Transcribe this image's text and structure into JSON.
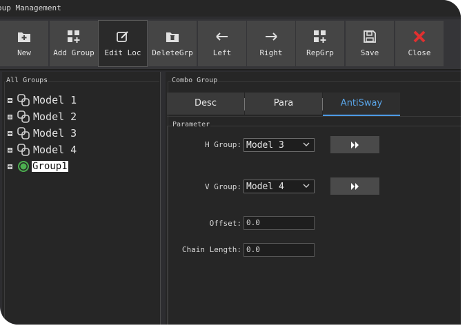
{
  "window": {
    "title": "oup Management"
  },
  "toolbar": {
    "buttons": [
      {
        "label": "New",
        "icon": "folder-plus-icon"
      },
      {
        "label": "Add Group",
        "icon": "grid-plus-icon"
      },
      {
        "label": "Edit Loc",
        "icon": "edit-icon"
      },
      {
        "label": "DeleteGrp",
        "icon": "folder-delete-icon"
      },
      {
        "label": "Left",
        "icon": "arrow-left-icon"
      },
      {
        "label": "Right",
        "icon": "arrow-right-icon"
      },
      {
        "label": "RepGrp",
        "icon": "grid-plus-icon"
      },
      {
        "label": "Save",
        "icon": "save-icon"
      },
      {
        "label": "Close",
        "icon": "close-icon"
      }
    ]
  },
  "tree": {
    "caption": "All Groups",
    "items": [
      {
        "label": "Model 1",
        "icon": "model-group-icon"
      },
      {
        "label": "Model 2",
        "icon": "model-group-icon"
      },
      {
        "label": "Model 3",
        "icon": "model-group-icon"
      },
      {
        "label": "Model 4",
        "icon": "model-group-icon"
      },
      {
        "label": "Group1",
        "icon": "status-dot-icon"
      }
    ]
  },
  "combo": {
    "caption": "Combo Group",
    "tabs": [
      "Desc",
      "Para",
      "AntiSway"
    ],
    "active_tab": "AntiSway",
    "parameter_caption": "Parameter",
    "h_group": {
      "label": "H Group:",
      "value": "Model 3"
    },
    "v_group": {
      "label": "V Group:",
      "value": "Model 4"
    },
    "offset": {
      "label": "Offset:",
      "value": "0.0"
    },
    "chain_length": {
      "label": "Chain Length:",
      "value": "0.0"
    }
  },
  "colors": {
    "accent": "#4d9be6",
    "close": "#e03030",
    "status_green": "#4caf50"
  }
}
